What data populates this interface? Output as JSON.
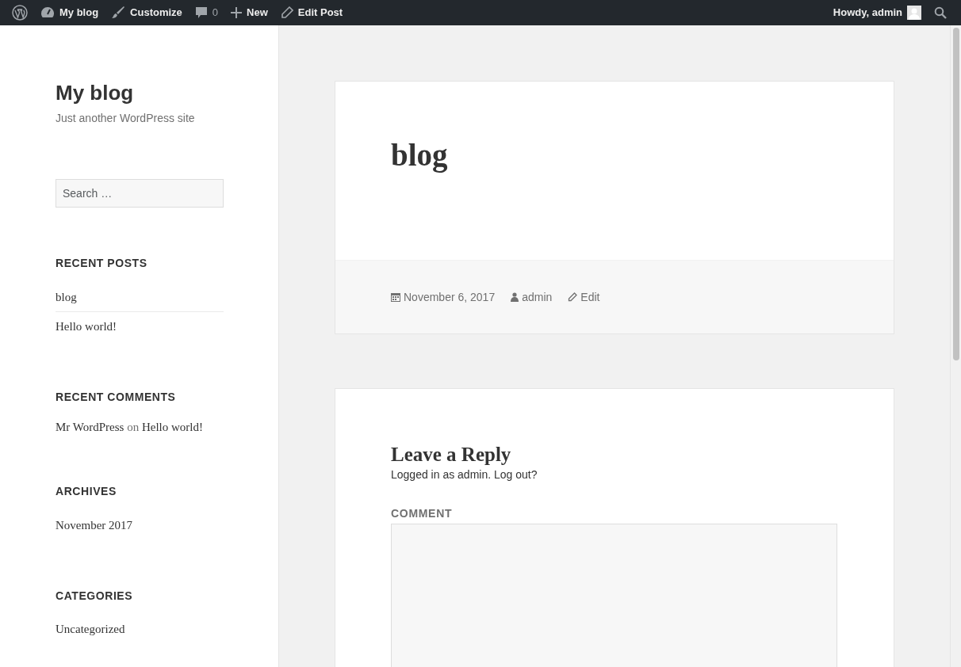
{
  "admin_bar": {
    "left": [
      {
        "kind": "logo"
      },
      {
        "kind": "site",
        "label": "My blog"
      },
      {
        "kind": "customize",
        "label": "Customize"
      },
      {
        "kind": "comments",
        "label": "0"
      },
      {
        "kind": "new",
        "label": "New"
      },
      {
        "kind": "edit",
        "label": "Edit Post"
      }
    ],
    "greeting": "Howdy, admin"
  },
  "sidebar": {
    "site_title": "My blog",
    "tagline": "Just another WordPress site",
    "search": {
      "placeholder": "Search …"
    },
    "widgets": [
      {
        "kind": "list",
        "title": "RECENT POSTS",
        "items": [
          "blog",
          "Hello world!"
        ]
      },
      {
        "kind": "comments",
        "title": "RECENT COMMENTS",
        "comments": [
          {
            "author": "Mr WordPress",
            "connector": "on",
            "post": "Hello world!"
          }
        ]
      },
      {
        "kind": "list",
        "title": "ARCHIVES",
        "items": [
          "November 2017"
        ]
      },
      {
        "kind": "list",
        "title": "CATEGORIES",
        "items": [
          "Uncategorized"
        ]
      }
    ]
  },
  "post": {
    "title": "blog",
    "date": "November 6, 2017",
    "author": "admin",
    "edit": "Edit"
  },
  "reply": {
    "title": "Leave a Reply",
    "logged_in": "Logged in as admin. Log out?",
    "comment_label": "COMMENT"
  }
}
